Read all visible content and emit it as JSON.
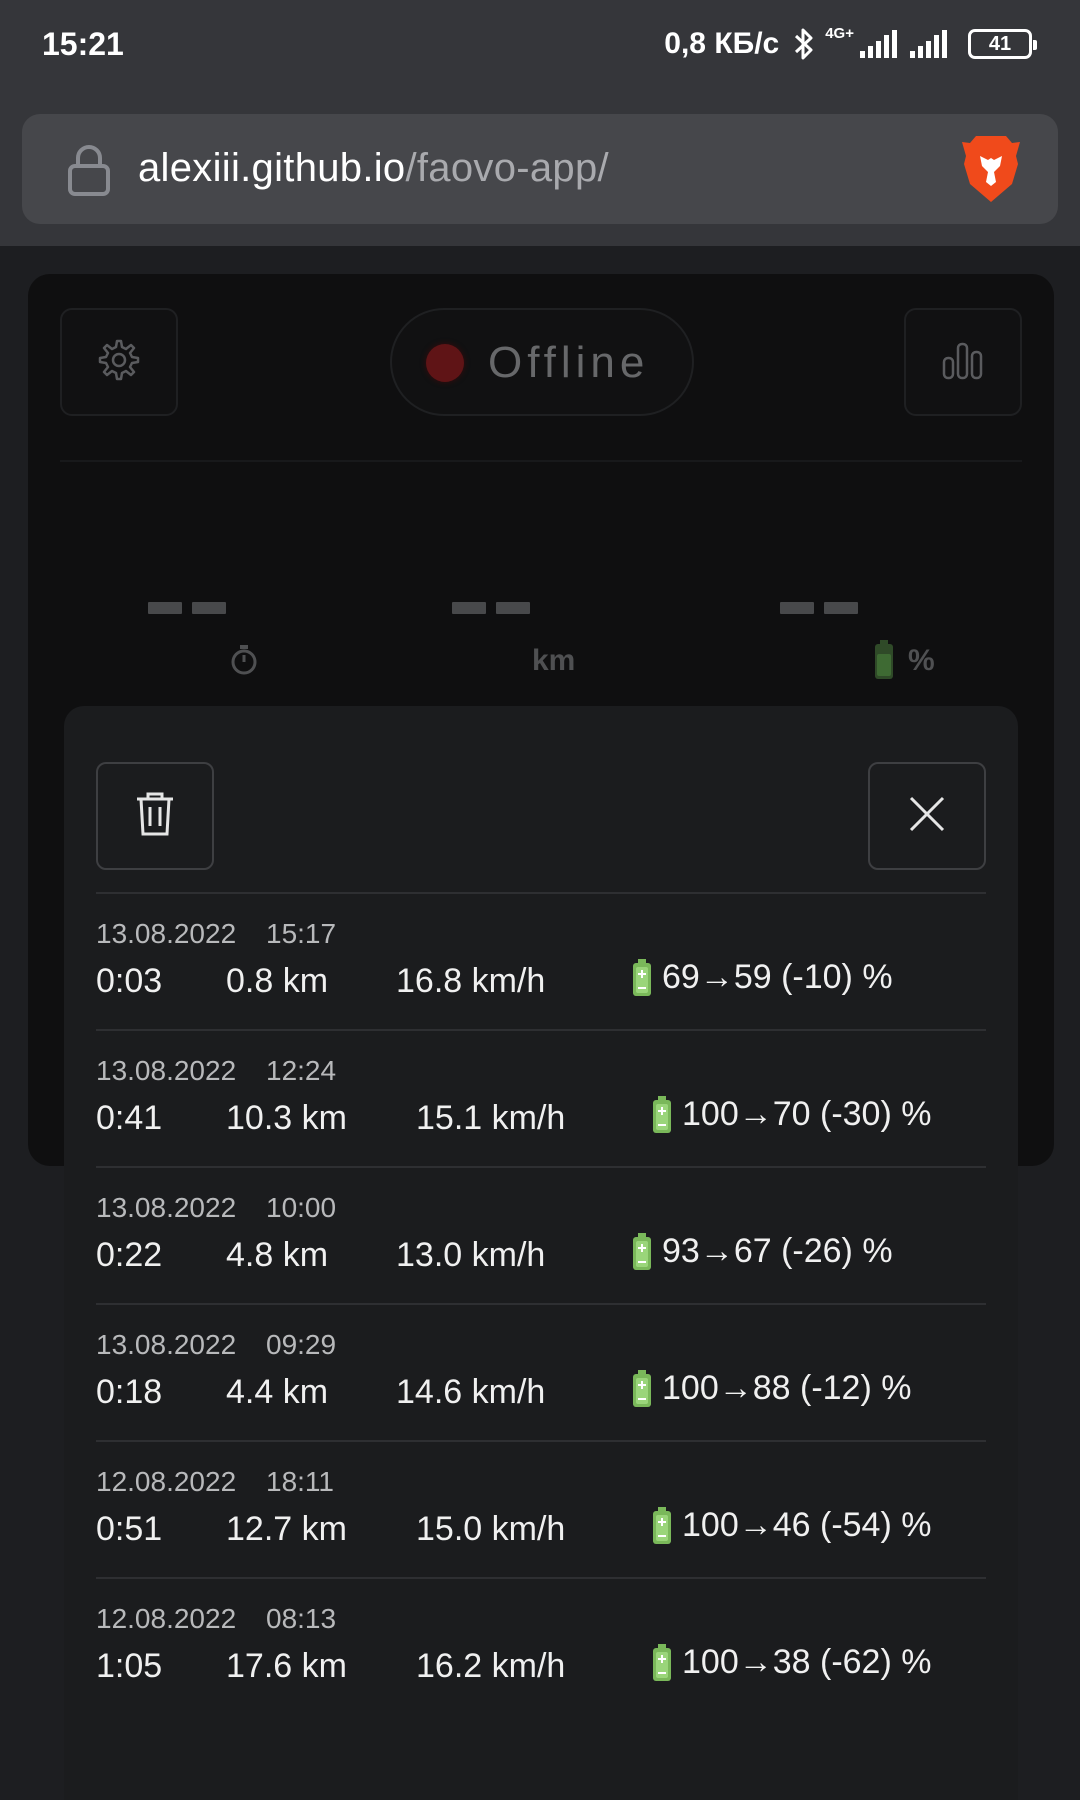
{
  "status_bar": {
    "time": "15:21",
    "net_speed": "0,8 КБ/с",
    "network_type": "4G+",
    "battery_level": "41",
    "icons": [
      "bluetooth-icon",
      "signal-icon",
      "signal-icon",
      "battery-icon"
    ]
  },
  "browser": {
    "url_domain": "alexiii.github.io",
    "url_path": "/faovo-app/",
    "icons": [
      "lock-icon",
      "brave-browser-icon"
    ]
  },
  "app": {
    "connection_status": "Offline",
    "status_color": "#5f1416",
    "icons": [
      "gear-icon",
      "bar-chart-icon",
      "stopwatch-icon",
      "battery-icon"
    ],
    "metrics": [
      {
        "value_placeholder": "--",
        "unit": ""
      },
      {
        "value_placeholder": "--",
        "unit": "km"
      },
      {
        "value_placeholder": "--",
        "unit": "%"
      }
    ]
  },
  "history": {
    "icons": [
      "trash-icon",
      "close-icon"
    ],
    "rides": [
      {
        "date": "13.08.2022",
        "time": "15:17",
        "duration": "0:03",
        "distance": "0.8 km",
        "speed": "16.8 km/h",
        "battery": "69→59 (-10) %"
      },
      {
        "date": "13.08.2022",
        "time": "12:24",
        "duration": "0:41",
        "distance": "10.3 km",
        "speed": "15.1 km/h",
        "battery": "100→70 (-30) %"
      },
      {
        "date": "13.08.2022",
        "time": "10:00",
        "duration": "0:22",
        "distance": "4.8 km",
        "speed": "13.0 km/h",
        "battery": "93→67 (-26) %"
      },
      {
        "date": "13.08.2022",
        "time": "09:29",
        "duration": "0:18",
        "distance": "4.4 km",
        "speed": "14.6 km/h",
        "battery": "100→88 (-12) %"
      },
      {
        "date": "12.08.2022",
        "time": "18:11",
        "duration": "0:51",
        "distance": "12.7 km",
        "speed": "15.0 km/h",
        "battery": "100→46 (-54) %"
      },
      {
        "date": "12.08.2022",
        "time": "08:13",
        "duration": "1:05",
        "distance": "17.6 km",
        "speed": "16.2 km/h",
        "battery": "100→38 (-62) %"
      }
    ]
  }
}
